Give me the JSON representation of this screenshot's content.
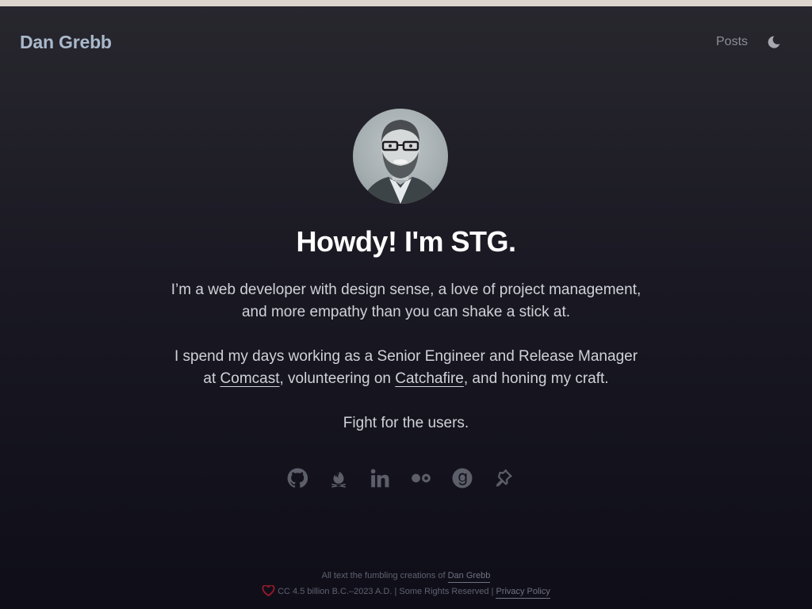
{
  "header": {
    "site_title": "Dan Grebb",
    "nav_posts": "Posts",
    "theme_toggle_icon": "moon-icon"
  },
  "hero": {
    "avatar_alt": "Dan Grebb",
    "headline": "Howdy! I'm STG."
  },
  "bio": {
    "p1": "I’m a web developer with design sense, a love of project management, and more empathy than you can shake a stick at.",
    "p2_before": "I spend my days working as a Senior Engineer and Release Manager at ",
    "p2_link1": "Comcast",
    "p2_middle": ", volunteering on ",
    "p2_link2": "Catchafire",
    "p2_after": ", and honing my craft.",
    "p3": "Fight for the users."
  },
  "social": [
    {
      "icon": "github-icon"
    },
    {
      "icon": "campfire-icon"
    },
    {
      "icon": "linkedin-icon"
    },
    {
      "icon": "flickr-icon"
    },
    {
      "icon": "goodreads-icon"
    },
    {
      "icon": "pin-icon"
    }
  ],
  "footer": {
    "line1_text": "All text the fumbling creations of ",
    "line1_link": "Dan Grebb",
    "line2_text": "CC 4.5 billion B.C.–2023 A.D. | Some Rights Reserved | ",
    "line2_link": "Privacy Policy",
    "heart_color": "#a01a2a"
  },
  "colors": {
    "accent_title": "#a9b9cb",
    "top_bar": "#ddd5cc",
    "background_top": "#28272e",
    "background_bottom": "#0f0e18"
  }
}
